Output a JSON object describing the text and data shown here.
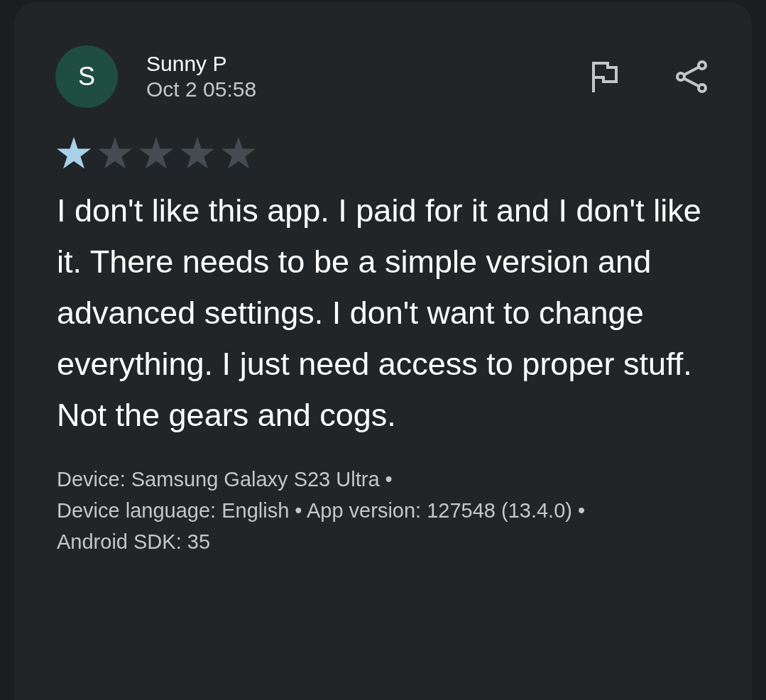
{
  "review": {
    "avatar": "S",
    "author": "Sunny P",
    "date": "Oct 2 05:58",
    "stars": 1,
    "text": "I don't like this app. I paid for it and I don't like it. There needs to be a simple version and advanced settings. I don't want to change everything. I just need access to proper stuff. Not the gears and cogs.",
    "details": [
      "Device: Samsung Galaxy S23 Ultra •",
      "Device language: English • App version: 127548 (13.4.0) •",
      "Android SDK: 35"
    ]
  }
}
